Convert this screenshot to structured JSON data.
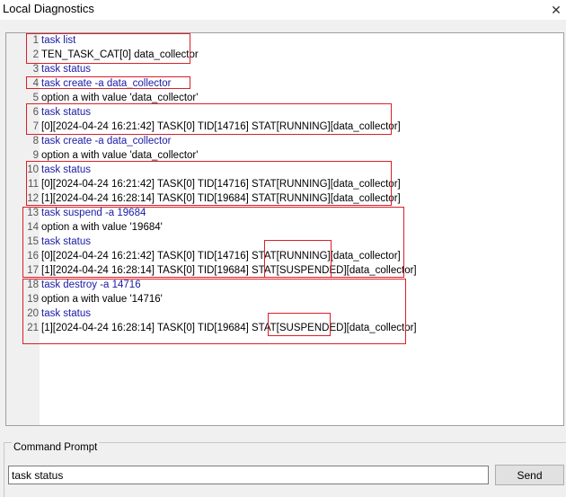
{
  "window": {
    "title": "Local Diagnostics",
    "close_glyph": "✕"
  },
  "log": {
    "lines": [
      {
        "n": "1",
        "text": "task list",
        "kind": "cmd"
      },
      {
        "n": "2",
        "text": "TEN_TASK_CAT[0] data_collector",
        "kind": "out"
      },
      {
        "n": "3",
        "text": "task status",
        "kind": "cmd"
      },
      {
        "n": "4",
        "text": "task create -a data_collector",
        "kind": "cmd"
      },
      {
        "n": "5",
        "text": "option a with value 'data_collector'",
        "kind": "out"
      },
      {
        "n": "6",
        "text": "task status",
        "kind": "cmd"
      },
      {
        "n": "7",
        "text": "[0][2024-04-24 16:21:42] TASK[0] TID[14716] STAT[RUNNING][data_collector]",
        "kind": "out"
      },
      {
        "n": "8",
        "text": "task create -a data_collector",
        "kind": "cmd"
      },
      {
        "n": "9",
        "text": "option a with value 'data_collector'",
        "kind": "out"
      },
      {
        "n": "10",
        "text": "task status",
        "kind": "cmd"
      },
      {
        "n": "11",
        "text": "[0][2024-04-24 16:21:42] TASK[0] TID[14716] STAT[RUNNING][data_collector]",
        "kind": "out"
      },
      {
        "n": "12",
        "text": "[1][2024-04-24 16:28:14] TASK[0] TID[19684] STAT[RUNNING][data_collector]",
        "kind": "out"
      },
      {
        "n": "13",
        "text": "task suspend -a 19684",
        "kind": "cmd"
      },
      {
        "n": "14",
        "text": "option a with value '19684'",
        "kind": "out"
      },
      {
        "n": "15",
        "text": "task status",
        "kind": "cmd"
      },
      {
        "n": "16",
        "text": "[0][2024-04-24 16:21:42] TASK[0] TID[14716] STAT[RUNNING][data_collector]",
        "kind": "out"
      },
      {
        "n": "17",
        "text": "[1][2024-04-24 16:28:14] TASK[0] TID[19684] STAT[SUSPENDED][data_collector]",
        "kind": "out"
      },
      {
        "n": "18",
        "text": "task destroy -a 14716",
        "kind": "cmd"
      },
      {
        "n": "19",
        "text": "option a with value '14716'",
        "kind": "out"
      },
      {
        "n": "20",
        "text": "task status",
        "kind": "cmd"
      },
      {
        "n": "21",
        "text": "[1][2024-04-24 16:28:14] TASK[0] TID[19684] STAT[SUSPENDED][data_collector]",
        "kind": "out"
      }
    ]
  },
  "command_prompt": {
    "label": "Command Prompt",
    "input_value": "task status",
    "send_label": "Send"
  },
  "colors": {
    "command_text": "#1a1aa6",
    "highlight_border": "#d9202a"
  }
}
